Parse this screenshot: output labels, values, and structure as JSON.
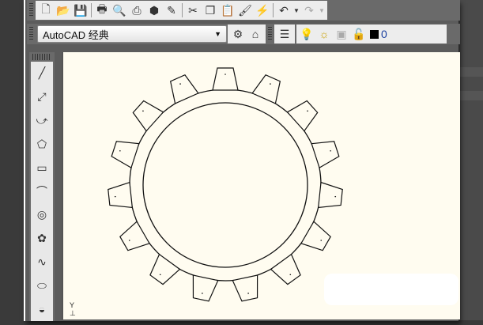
{
  "toolbar_standard": {
    "icons": [
      "new-icon",
      "open-icon",
      "save-icon",
      "plot-icon",
      "plot-preview-icon",
      "publish-icon",
      "3d-dwf-icon",
      "batch-plot-icon",
      "cut-icon",
      "copy-icon",
      "paste-icon",
      "match-properties-icon",
      "block-editor-icon",
      "undo-icon",
      "redo-icon"
    ]
  },
  "workspace": {
    "selected": "AutoCAD 经典"
  },
  "layers": {
    "current_layer": "0",
    "layer_color": "#000000"
  },
  "draw_toolbar": {
    "tools": [
      "line",
      "construction-line",
      "polyline",
      "polygon",
      "rectangle",
      "arc",
      "circle",
      "revision-cloud",
      "spline",
      "ellipse",
      "ellipse-arc"
    ]
  },
  "canvas": {
    "background": "#fffcf0",
    "ucs_label": "Y",
    "gear_teeth": 15
  }
}
